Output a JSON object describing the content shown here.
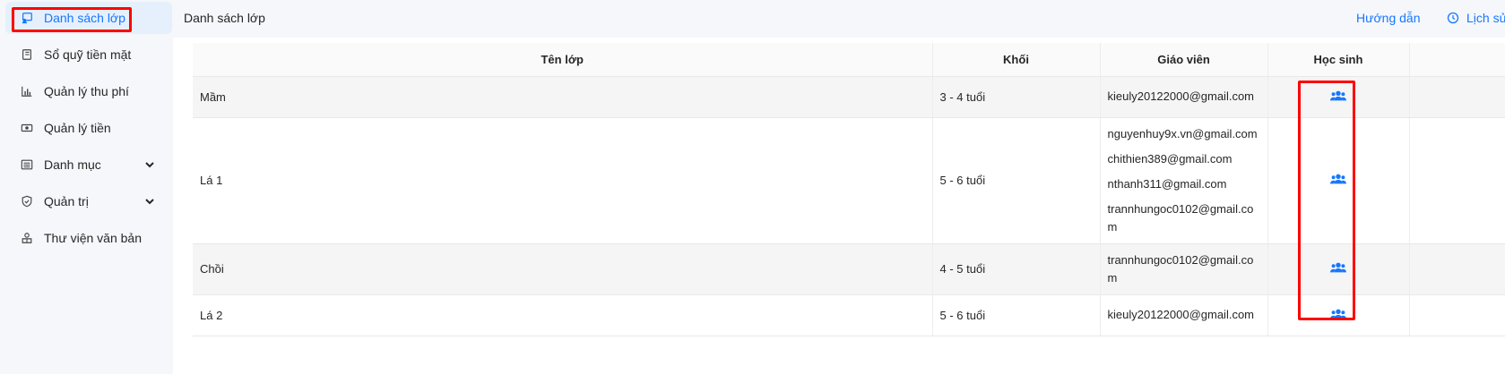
{
  "sidebar": {
    "items": [
      {
        "label": "Danh sách lớp",
        "icon": "class-list-icon",
        "active": true
      },
      {
        "label": "Sổ quỹ tiền mặt",
        "icon": "cashbook-icon"
      },
      {
        "label": "Quản lý thu phí",
        "icon": "bar-chart-icon"
      },
      {
        "label": "Quản lý tiền",
        "icon": "money-icon"
      },
      {
        "label": "Danh mục",
        "icon": "list-icon",
        "expandable": true
      },
      {
        "label": "Quản trị",
        "icon": "shield-icon",
        "expandable": true
      },
      {
        "label": "Thư viện văn bản",
        "icon": "library-icon"
      }
    ]
  },
  "header": {
    "title": "Danh sách lớp",
    "guide_label": "Hướng dẫn",
    "history_label": "Lịch sử"
  },
  "table": {
    "columns": [
      "Tên lớp",
      "Khối",
      "Giáo viên",
      "Học sinh"
    ],
    "rows": [
      {
        "name": "Mầm",
        "grade": "3 - 4 tuổi",
        "teachers": [
          "kieuly20122000@gmail.com"
        ]
      },
      {
        "name": "Lá 1",
        "grade": "5 - 6 tuổi",
        "teachers": [
          "nguyenhuy9x.vn@gmail.com",
          "chithien389@gmail.com",
          "nthanh311@gmail.com",
          "trannhungoc0102@gmail.com"
        ]
      },
      {
        "name": "Chồi",
        "grade": "4 - 5 tuổi",
        "teachers": [
          "trannhungoc0102@gmail.com"
        ]
      },
      {
        "name": "Lá 2",
        "grade": "5 - 6 tuổi",
        "teachers": [
          "kieuly20122000@gmail.com"
        ]
      }
    ]
  },
  "colors": {
    "accent": "#1677ff",
    "annotation": "#ff0000"
  }
}
